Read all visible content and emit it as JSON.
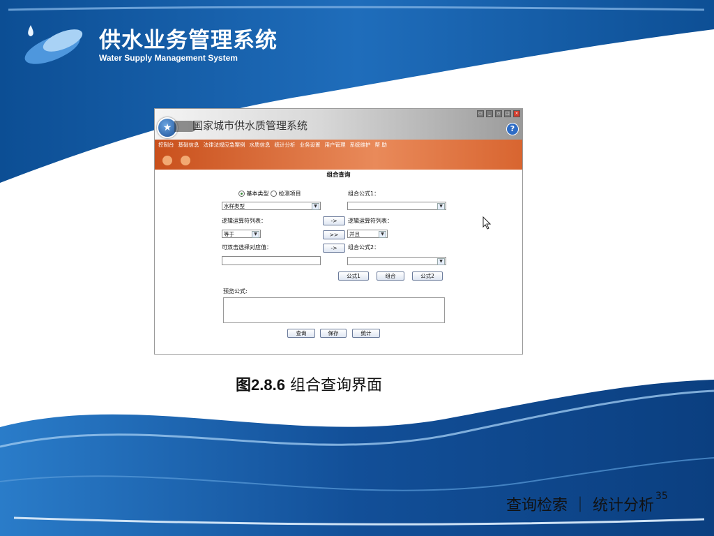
{
  "slide": {
    "title": "供水业务管理系统",
    "subtitle": "Water Supply Management System",
    "caption_num": "图2.8.6",
    "caption_text": "组合查询界面",
    "footer": "查询检索 ｜ 统计分析",
    "page_number": "35"
  },
  "app": {
    "title": "国家城市供水质管理系统",
    "help": "?",
    "menu": [
      "控制台",
      "基础信息",
      "法律法规应急案例",
      "水质信息",
      "统计分析",
      "业务设置",
      "用户管理",
      "系统维护",
      "帮 助"
    ],
    "form": {
      "title": "组合查询",
      "radio_basic": "基本类型",
      "radio_item": "检测项目",
      "type_select": "水样类型",
      "op_list_label": "逻辑运算符列表：",
      "op_select": "等于",
      "value_label": "可双击选择对应值：",
      "formula1_label": "组合公式1：",
      "formula1_select": "",
      "logic_list_label": "逻辑运算符列表：",
      "logic_select": "并且",
      "formula2_label": "组合公式2：",
      "formula2_select": "",
      "arrow1": "->",
      "arrow2": ">>",
      "arrow3": "->",
      "btn_formula1": "公式1",
      "btn_combine": "组合",
      "btn_formula2": "公式2",
      "preview_label": "预览公式:",
      "btn_query": "查询",
      "btn_save": "保存",
      "btn_stats": "统计"
    }
  },
  "colors": {
    "header_blue": "#1a5fa8",
    "menu_orange": "#d8622c",
    "accent": "#2e6cc5"
  }
}
